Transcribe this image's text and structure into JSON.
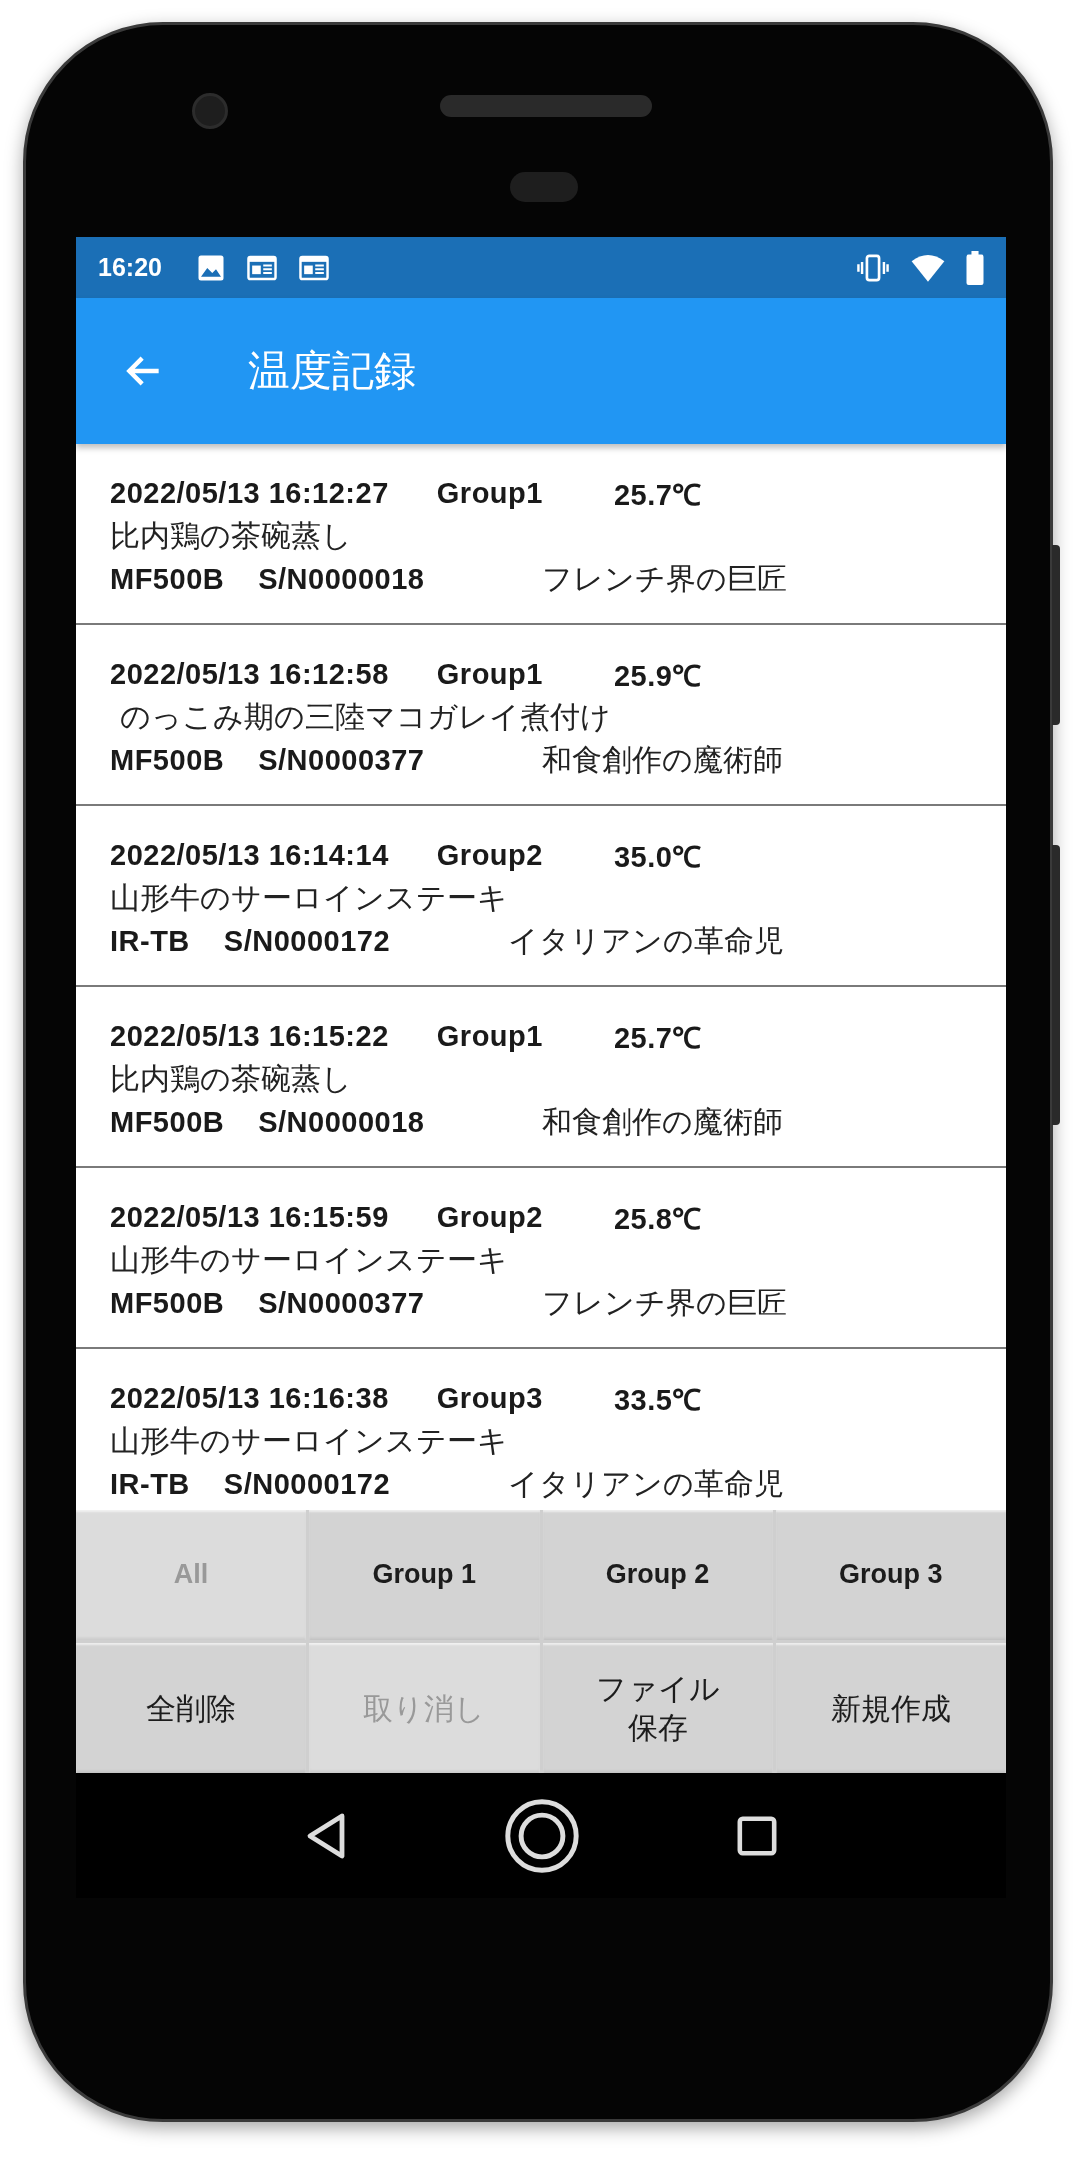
{
  "status_bar": {
    "time": "16:20"
  },
  "app_bar": {
    "title": "温度記録"
  },
  "records": [
    {
      "datetime": "2022/05/13 16:12:27",
      "group": "Group1",
      "temperature": "25.7℃",
      "dish": "比内鶏の茶碗蒸し",
      "model": "MF500B",
      "serial": "S/N0000018",
      "chef": "フレンチ界の巨匠"
    },
    {
      "datetime": "2022/05/13 16:12:58",
      "group": "Group1",
      "temperature": "25.9℃",
      "dish": " のっこみ期の三陸マコガレイ煮付け",
      "model": "MF500B",
      "serial": "S/N0000377",
      "chef": "和食創作の魔術師"
    },
    {
      "datetime": "2022/05/13 16:14:14",
      "group": "Group2",
      "temperature": "35.0℃",
      "dish": "山形牛のサーロインステーキ",
      "model": "IR-TB",
      "serial": "S/N0000172",
      "chef": "イタリアンの革命児"
    },
    {
      "datetime": "2022/05/13 16:15:22",
      "group": "Group1",
      "temperature": "25.7℃",
      "dish": "比内鶏の茶碗蒸し",
      "model": "MF500B",
      "serial": "S/N0000018",
      "chef": "和食創作の魔術師"
    },
    {
      "datetime": "2022/05/13 16:15:59",
      "group": "Group2",
      "temperature": "25.8℃",
      "dish": "山形牛のサーロインステーキ",
      "model": "MF500B",
      "serial": "S/N0000377",
      "chef": "フレンチ界の巨匠"
    },
    {
      "datetime": "2022/05/13 16:16:38",
      "group": "Group3",
      "temperature": "33.5℃",
      "dish": "山形牛のサーロインステーキ",
      "model": "IR-TB",
      "serial": "S/N0000172",
      "chef": "イタリアンの革命児"
    }
  ],
  "filter_buttons": [
    {
      "label": "All",
      "disabled": true
    },
    {
      "label": "Group 1",
      "disabled": false
    },
    {
      "label": "Group 2",
      "disabled": false
    },
    {
      "label": "Group 3",
      "disabled": false
    }
  ],
  "action_buttons": [
    {
      "label": "全削除",
      "disabled": false
    },
    {
      "label": "取り消し",
      "disabled": true
    },
    {
      "label": "ファイル保存",
      "disabled": false
    },
    {
      "label": "新規作成",
      "disabled": false
    }
  ]
}
